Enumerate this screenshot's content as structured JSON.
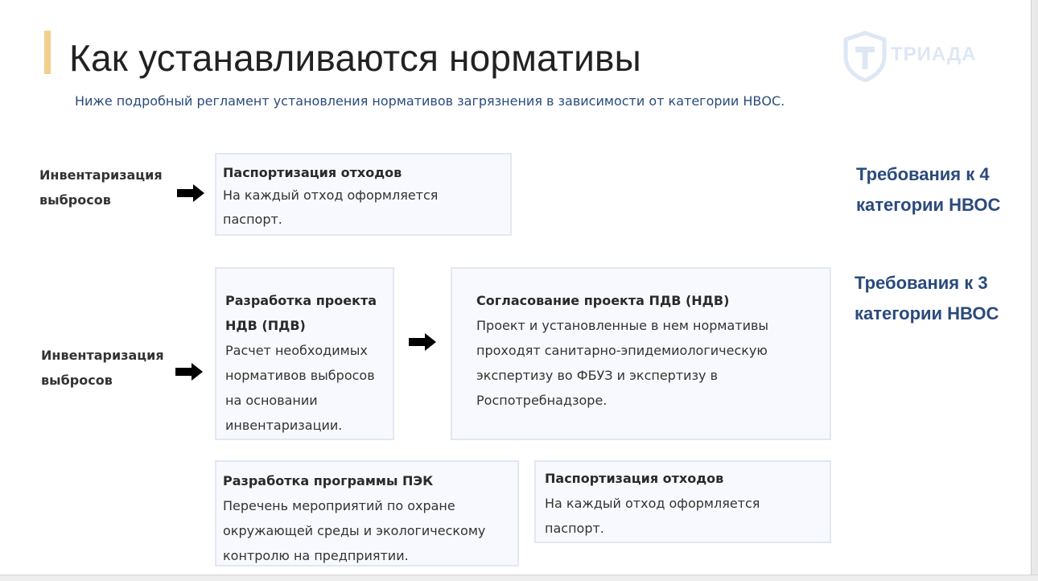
{
  "slide": {
    "title": "Как устанавливаются нормативы",
    "subtitle": "Ниже подробный регламент установления нормативов загрязнения в зависимости от категории НВОС.",
    "logo": {
      "text": "ТРИАДА",
      "icon": "shield-t-logo-icon"
    }
  },
  "row4": {
    "label_line1": "Инвентаризация",
    "label_line2": "выбросов",
    "box": {
      "title": "Паспортизация отходов",
      "lines": [
        "На каждый отход оформляется",
        "паспорт."
      ]
    },
    "requirement_line1": "Требования к 4",
    "requirement_line2": "категории НВОС"
  },
  "row3": {
    "label_line1": "Инвентаризация",
    "label_line2": "выбросов",
    "box_project": {
      "title_lines": [
        "Разработка проекта",
        "НДВ (ПДВ)"
      ],
      "lines": [
        "Расчет необходимых",
        "нормативов выбросов",
        "на основании",
        "инвентаризации."
      ]
    },
    "box_approval": {
      "title": "Согласование проекта ПДВ (НДВ)",
      "lines": [
        "Проект и установленные в нем нормативы",
        "проходят санитарно-эпидемиологическую",
        "экспертизу во ФБУЗ и экспертизу в",
        "Роспотребнадзоре."
      ]
    },
    "box_pek": {
      "title": "Разработка программы ПЭК",
      "lines": [
        "Перечень мероприятий по охране",
        "окружающей среды и экологическому",
        "контролю на предприятии."
      ]
    },
    "box_waste": {
      "title": "Паспортизация отходов",
      "lines": [
        "На каждый отход оформляется",
        "паспорт."
      ]
    },
    "requirement_line1": "Требования к 3",
    "requirement_line2": "категории НВОС"
  },
  "colors": {
    "accent_bar": "#f1cf8c",
    "heading_blue": "#2b4a7c",
    "box_bg": "#f8f9fe",
    "box_border": "#e3e7f1"
  }
}
